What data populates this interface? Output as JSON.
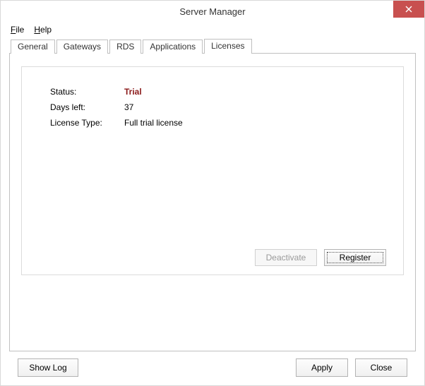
{
  "window": {
    "title": "Server Manager"
  },
  "menu": {
    "file": "File",
    "help": "Help"
  },
  "tabs": {
    "general": "General",
    "gateways": "Gateways",
    "rds": "RDS",
    "applications": "Applications",
    "licenses": "Licenses"
  },
  "license": {
    "status_label": "Status:",
    "status_value": "Trial",
    "days_left_label": "Days left:",
    "days_left_value": "37",
    "type_label": "License Type:",
    "type_value": "Full trial license"
  },
  "buttons": {
    "deactivate": "Deactivate",
    "register": "Register",
    "show_log": "Show Log",
    "apply": "Apply",
    "close": "Close"
  }
}
